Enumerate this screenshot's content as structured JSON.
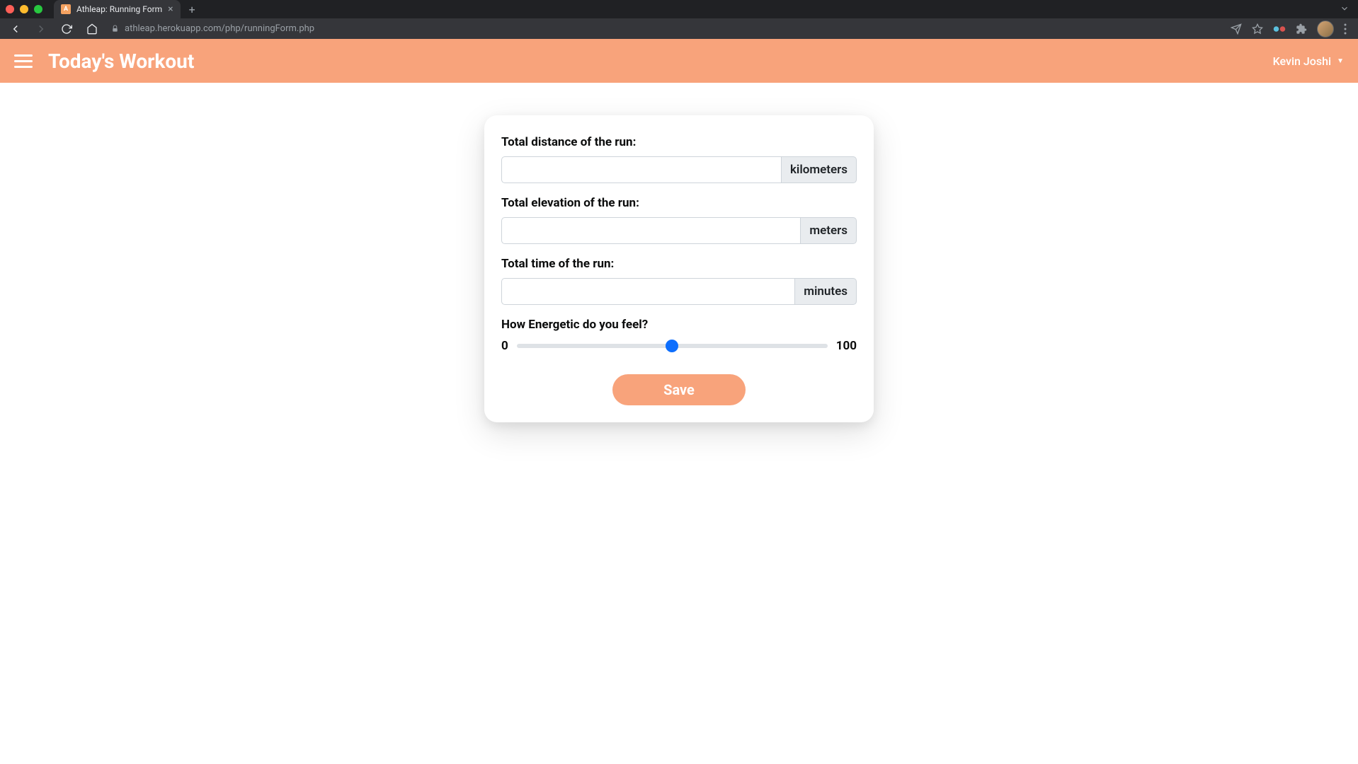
{
  "browser": {
    "tab_title": "Athleap: Running Form",
    "favicon_letter": "A",
    "url": "athleap.herokuapp.com/php/runningForm.php"
  },
  "header": {
    "title": "Today's Workout",
    "user_name": "Kevin Joshi"
  },
  "form": {
    "distance": {
      "label": "Total distance of the run:",
      "value": "",
      "unit": "kilometers"
    },
    "elevation": {
      "label": "Total elevation of the run:",
      "value": "",
      "unit": "meters"
    },
    "time": {
      "label": "Total time of the run:",
      "value": "",
      "unit": "minutes"
    },
    "energy": {
      "label": "How Energetic do you feel?",
      "min_label": "0",
      "max_label": "100",
      "value": 50
    },
    "save_label": "Save"
  }
}
